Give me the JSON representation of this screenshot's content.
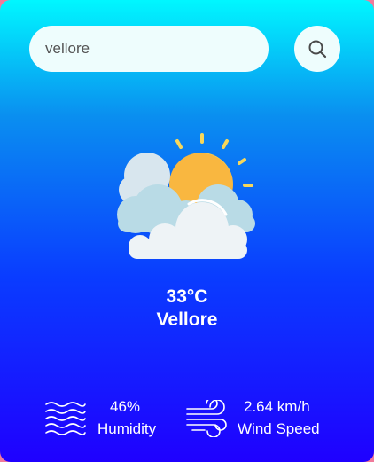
{
  "search": {
    "value": "vellore",
    "button_icon": "search-icon"
  },
  "weather": {
    "icon": "partly-cloudy-icon",
    "temperature": "33°C",
    "city": "Vellore"
  },
  "details": {
    "humidity": {
      "value": "46%",
      "label": "Humidity",
      "icon": "humidity-waves-icon"
    },
    "wind": {
      "value": "2.64 km/h",
      "label": "Wind Speed",
      "icon": "wind-icon"
    }
  },
  "colors": {
    "gradient_top": "#00f7ff",
    "gradient_bottom": "#1f00ff",
    "text": "#ffffff"
  }
}
